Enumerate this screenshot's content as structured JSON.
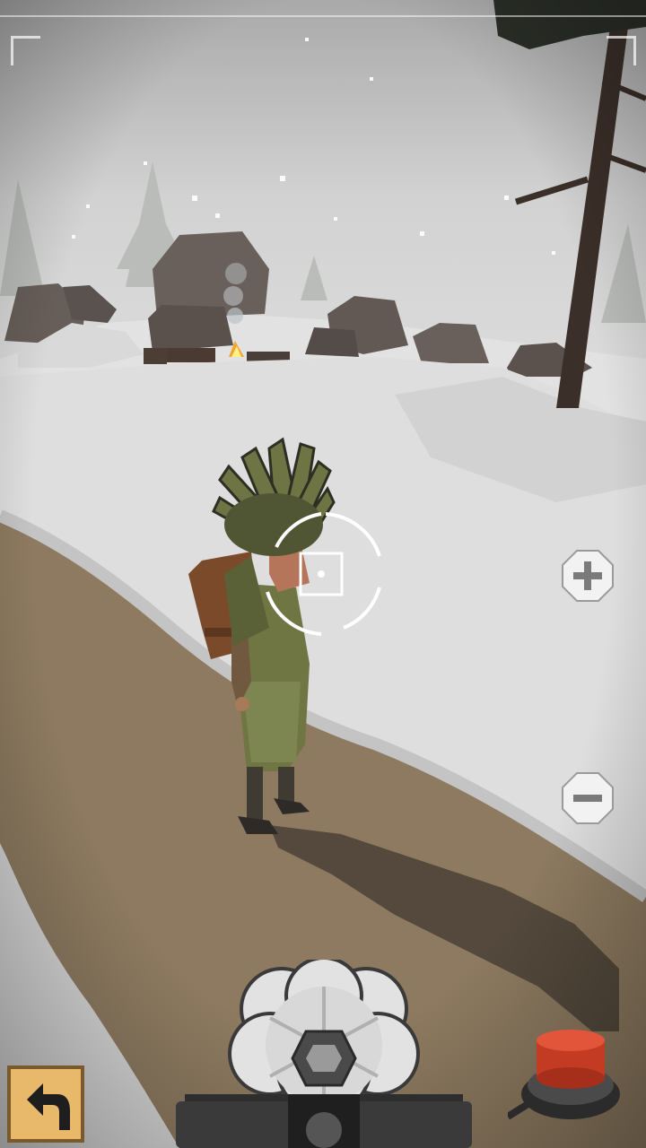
{
  "hud": {
    "zoom_in_icon": "plus-icon",
    "zoom_out_icon": "minus-icon",
    "back_icon": "return-arrow-icon",
    "shutter_icon": "red-shutter-button"
  },
  "colors": {
    "sky": "#cfcfcf",
    "snow": "#e4e4e4",
    "path": "#8f7a5e",
    "shadow": "#4e4438",
    "rock": "#5f5550",
    "tree_trunk": "#3a2e28",
    "shutter_red": "#d84a2e",
    "back_button": "#e8b96a"
  }
}
